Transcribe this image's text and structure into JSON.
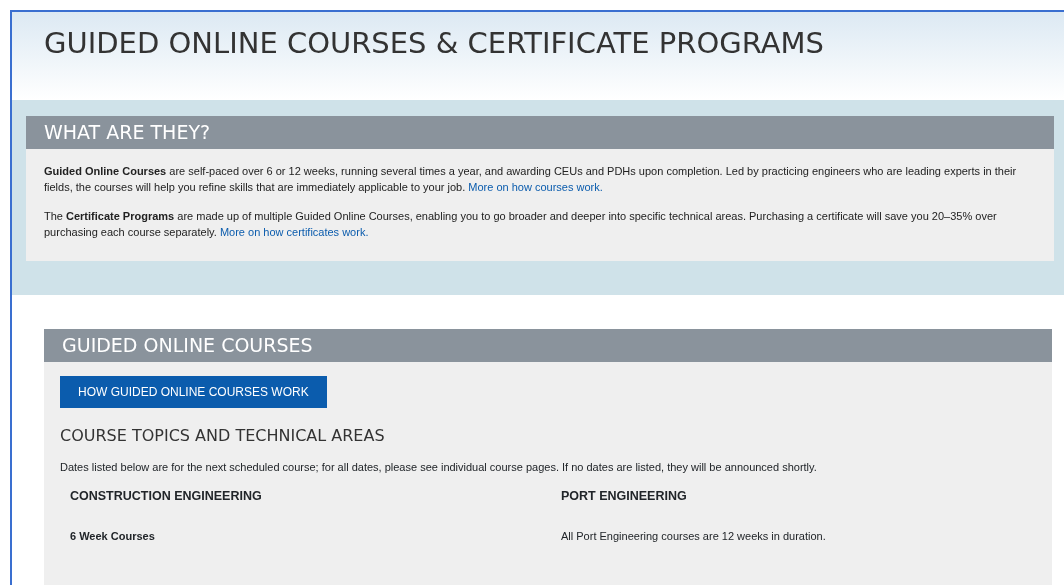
{
  "page_title": "GUIDED ONLINE COURSES & CERTIFICATE PROGRAMS",
  "intro": {
    "heading": "WHAT ARE THEY?",
    "paragraphs": [
      {
        "text": "**Guided Online Courses** are self-paced over 6 or 12 weeks, running several times a year, and awarding CEUs and PDHs upon completion. Led by practicing engineers who are leading experts in their fields, the courses will help you refine skills that are immediately applicable to your job.",
        "link": "More on how courses work."
      },
      {
        "text": "The **Certificate Programs** are made up of multiple Guided Online Courses, enabling you to go broader and deeper into specific technical areas. Purchasing a certificate will save you 20–35% over purchasing each course separately.",
        "link": "More on how certificates work."
      }
    ]
  },
  "courses": {
    "heading": "GUIDED ONLINE COURSES",
    "button": "HOW GUIDED ONLINE COURSES WORK",
    "subheading": "COURSE TOPICS AND TECHNICAL AREAS",
    "note": "Dates listed below are for the next scheduled course; for all dates, please see individual course pages. If no dates are listed, they will be announced shortly.",
    "areas": [
      {
        "title": "CONSTRUCTION ENGINEERING",
        "kind": "heading",
        "line": "6 Week Courses"
      },
      {
        "title": "PORT ENGINEERING",
        "kind": "plain",
        "line": "All Port Engineering courses are 12 weeks in duration."
      }
    ]
  }
}
